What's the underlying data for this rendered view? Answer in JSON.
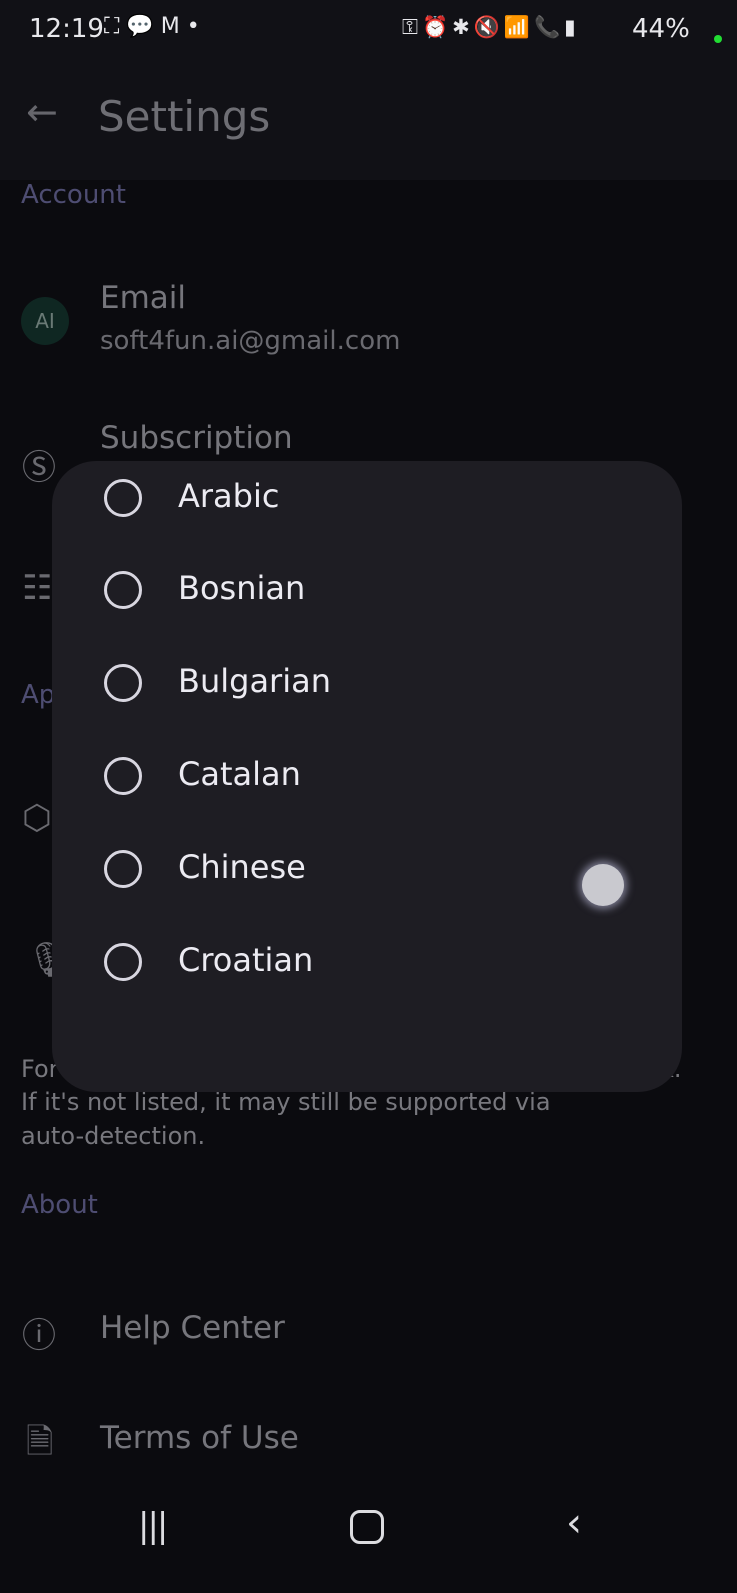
{
  "status": {
    "time": "12:19",
    "battery": "44%",
    "icons": [
      "screenshot-icon",
      "line-icon",
      "gmail-icon",
      "dot-icon",
      "vpn-key-icon",
      "alarm-icon",
      "bluetooth-icon",
      "mute-icon",
      "wifi-icon",
      "wifi-call-icon",
      "signal-icon",
      "battery-charging-icon"
    ]
  },
  "appbar": {
    "title": "Settings"
  },
  "account": {
    "section": "Account",
    "avatar": "AI",
    "email_label": "Email",
    "email": "soft4fun.ai@gmail.com",
    "subscription_label": "Subscription"
  },
  "app_section_partial": "Ap",
  "note": {
    "line1_start": "For",
    "line1_end": "k.",
    "line2": "If it's not listed, it may still be supported via",
    "line3": "auto-detection."
  },
  "about": {
    "section": "About",
    "help": "Help Center",
    "terms": "Terms of Use"
  },
  "dialog": {
    "options": [
      "Arabic",
      "Bosnian",
      "Bulgarian",
      "Catalan",
      "Chinese",
      "Croatian"
    ],
    "selected": null
  }
}
